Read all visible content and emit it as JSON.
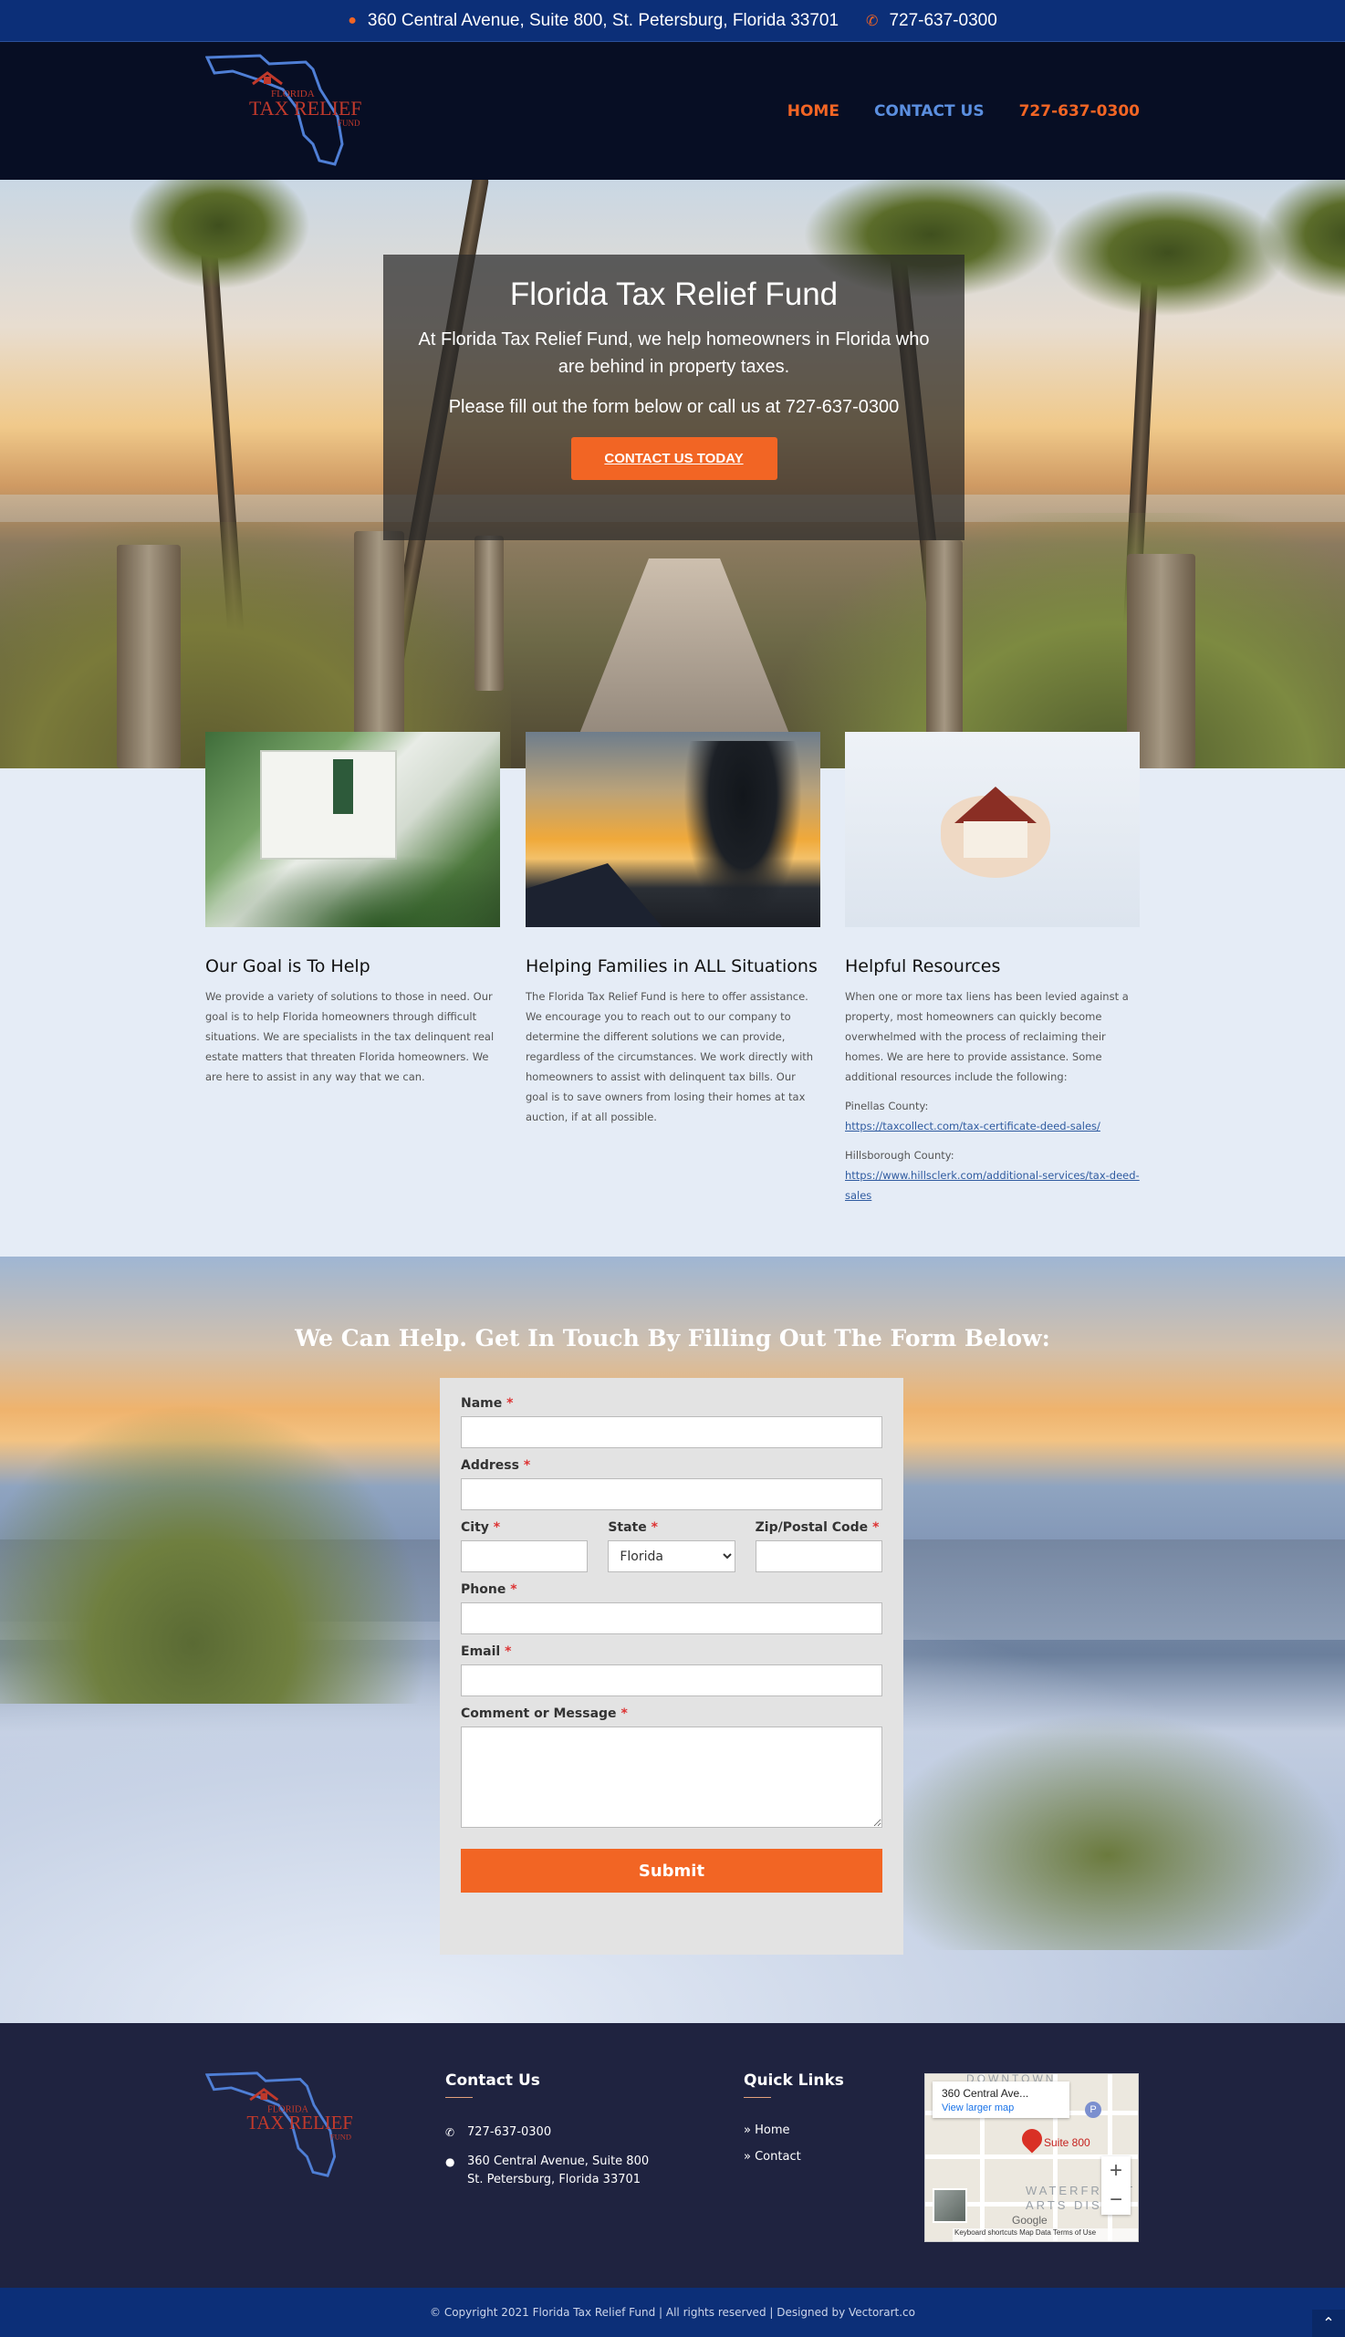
{
  "topbar": {
    "address": "360 Central Avenue, Suite 800, St. Petersburg, Florida 33701",
    "phone": "727-637-0300"
  },
  "logo": {
    "line1": "FLORIDA",
    "line2": "TAX RELIEF",
    "line3": "FUND"
  },
  "nav": {
    "home": "HOME",
    "contact": "CONTACT US",
    "phone": "727-637-0300"
  },
  "hero": {
    "title": "Florida Tax Relief Fund",
    "text1": "At Florida Tax Relief Fund, we help homeowners in Florida who are behind in property taxes.",
    "text2": "Please fill out the form below or call us at 727-637-0300",
    "button": "CONTACT US TODAY"
  },
  "features": [
    {
      "title": "Our Goal is To Help",
      "body": "We provide a variety of solutions to those in need. Our goal is to help Florida homeowners through difficult situations. We are specialists in the tax delinquent real estate matters that threaten Florida homeowners. We are here to assist in any way that we can."
    },
    {
      "title": "Helping Families in ALL Situations",
      "body": "The Florida Tax Relief Fund is here to offer assistance. We encourage you to reach out to our company to determine the different solutions we can provide, regardless of the circumstances. We work directly with homeowners to assist with delinquent tax bills. Our goal is to save owners from losing their homes at tax auction, if at all possible."
    },
    {
      "title": "Helpful Resources",
      "body": "When one or more tax liens has been levied against a property, most homeowners can quickly become overwhelmed with the process of reclaiming their homes. We are here to provide assistance. Some additional resources include the following:",
      "pinellas_label": "Pinellas County:",
      "pinellas_link": "https://taxcollect.com/tax-certificate-deed-sales/",
      "hillsborough_label": "Hillsborough County:",
      "hillsborough_link": "https://www.hillsclerk.com/additional-services/tax-deed-sales"
    }
  ],
  "form": {
    "heading": "We Can Help. Get In Touch By Filling Out The Form Below:",
    "required_mark": "*",
    "name_label": "Name",
    "address_label": "Address",
    "city_label": "City",
    "state_label": "State",
    "state_value": "Florida",
    "zip_label": "Zip/Postal Code",
    "phone_label": "Phone",
    "email_label": "Email",
    "comment_label": "Comment or Message",
    "submit": "Submit"
  },
  "footer": {
    "contact_heading": "Contact Us",
    "phone": "727-637-0300",
    "address_line1": "360 Central Avenue, Suite 800",
    "address_line2": "St. Petersburg, Florida 33701",
    "quick_heading": "Quick Links",
    "quick_home": "Home",
    "quick_contact": "Contact",
    "map": {
      "place": "360 Central Ave...",
      "view_larger": "View larger map",
      "pin_label": "Suite 800",
      "area_top": "DOWNTOWN",
      "area_mid": "WATERFRONT ARTS DIST",
      "google": "Google",
      "attribution": "Keyboard shortcuts   Map Data   Terms of Use"
    },
    "copyright": "© Copyright 2021 Florida Tax Relief Fund | All rights reserved | Designed by Vectorart.co"
  },
  "colors": {
    "accent": "#f26524",
    "navy": "#0c2f78",
    "link_blue": "#5b8fe0"
  }
}
